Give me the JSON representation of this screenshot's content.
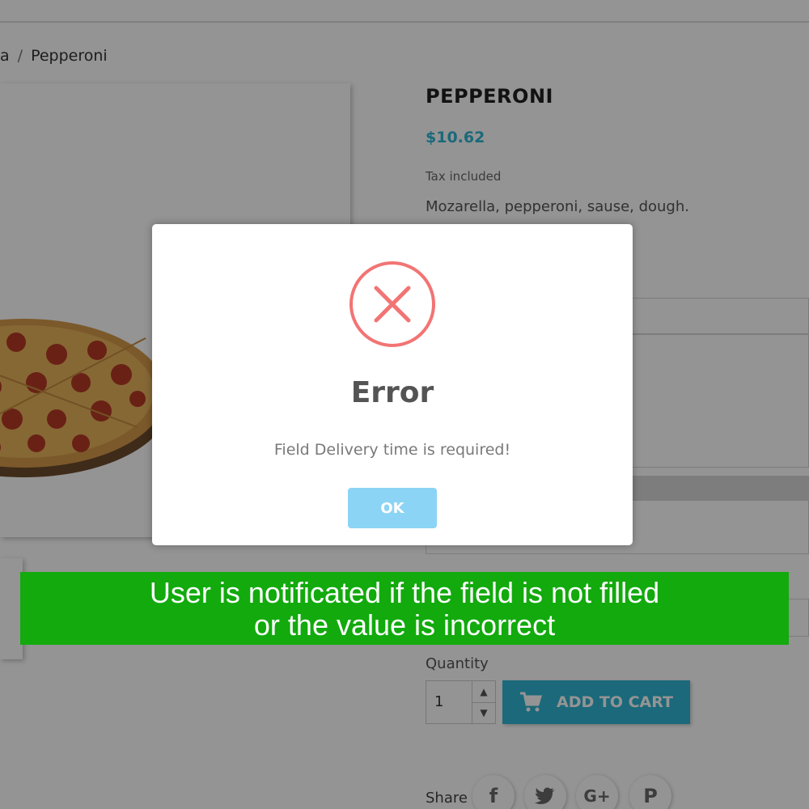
{
  "breadcrumb": {
    "partial": "a",
    "separator": "/",
    "current": "Pepperoni"
  },
  "product": {
    "title": "PEPPERONI",
    "price": "$10.62",
    "tax_note": "Tax included",
    "description": "Mozarella, pepperoni, sause, dough."
  },
  "purchase": {
    "quantity_label": "Quantity",
    "quantity_value": "1",
    "add_to_cart_label": "ADD TO CART",
    "cart_icon": "shopping-cart-icon"
  },
  "share": {
    "label": "Share",
    "buttons": [
      {
        "icon": "facebook-icon",
        "glyph": "f"
      },
      {
        "icon": "twitter-icon",
        "glyph": ""
      },
      {
        "icon": "google-plus-icon",
        "glyph": "G+"
      },
      {
        "icon": "pinterest-icon",
        "glyph": "P"
      }
    ]
  },
  "modal": {
    "icon": "error-x-icon",
    "title": "Error",
    "message": "Field Delivery time is required!",
    "ok_label": "OK"
  },
  "caption": {
    "line1": "User is notificated if the field is not filled",
    "line2": "or the value is incorrect"
  },
  "colors": {
    "accent": "#2fb5d2",
    "error": "#f27474",
    "ok_button": "#8cd4f5",
    "banner": "#12aa0d"
  }
}
